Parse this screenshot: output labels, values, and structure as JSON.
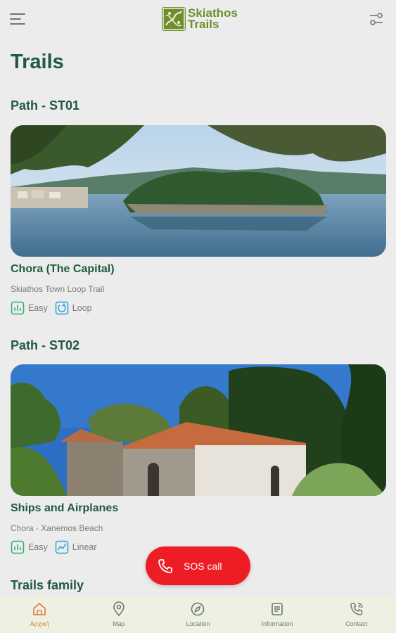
{
  "header": {
    "logo_line1": "Skiathos",
    "logo_line2": "Trails"
  },
  "page_title": "Trails",
  "trails": [
    {
      "path_title": "Path - ST01",
      "name": "Chora (The Capital)",
      "subtitle": "Skiathos Town Loop Trail",
      "difficulty": "Easy",
      "route_type": "Loop"
    },
    {
      "path_title": "Path - ST02",
      "name": "Ships and Airplanes",
      "subtitle": "Chora - Xanemos Beach",
      "difficulty": "Easy",
      "route_type": "Linear"
    }
  ],
  "next_section_title": "Trails family",
  "sos": {
    "label": "SOS call"
  },
  "bottom_nav": {
    "home": "Αρχική",
    "map": "Map",
    "location": "Location",
    "information": "Information",
    "contact": "Contact"
  },
  "colors": {
    "accent": "#1f5a40",
    "sos": "#ee1c25",
    "active_nav": "#e07a3a",
    "logo": "#6f8f2e"
  }
}
